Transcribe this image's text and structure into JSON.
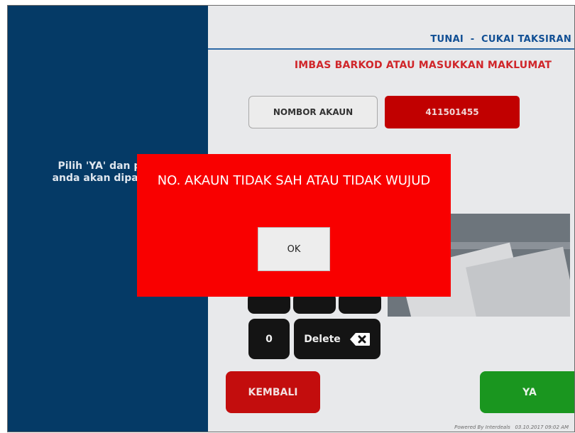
{
  "left_panel": {
    "instruction": "Pilih 'YA' dan pem\nanda akan dipapark"
  },
  "header": {
    "title": "TUNAI  -  CUKAI TAKSIRAN",
    "subtitle": "IMBAS BARKOD ATAU MASUKKAN MAKLUMAT"
  },
  "account": {
    "label": "NOMBOR AKAUN",
    "value": "411501455"
  },
  "keypad": {
    "zero": "0",
    "delete": "Delete"
  },
  "buttons": {
    "back": "KEMBALI",
    "yes": "YA"
  },
  "footer": {
    "powered_by": "Powered By Interdeals   03.10.2017 09:02 AM"
  },
  "modal": {
    "message": "NO. AKAUN TIDAK SAH ATAU TIDAK WUJUD",
    "ok": "OK"
  },
  "colors": {
    "left_panel": "#053a66",
    "modal": "#f90000",
    "account_value": "#c10000",
    "back_button": "#c30d0d",
    "yes_button": "#1a961f"
  },
  "icons": {
    "delete": "backspace-icon"
  }
}
